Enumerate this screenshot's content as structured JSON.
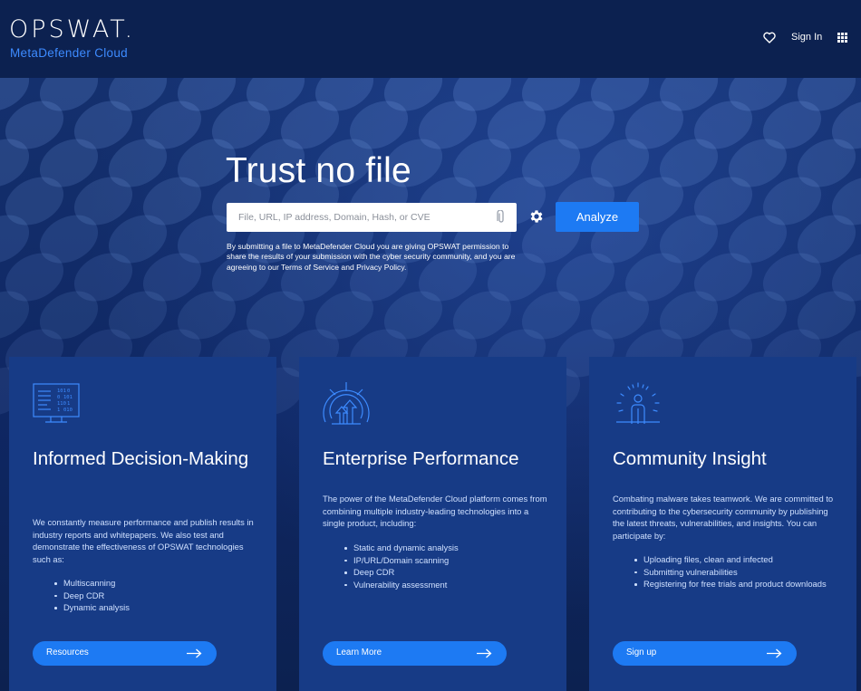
{
  "header": {
    "logo_word": "OPSWAT.",
    "logo_sub": "MetaDefender Cloud",
    "signin_label": "Sign In",
    "icons": [
      "heart-icon",
      "apps-grid-icon"
    ]
  },
  "hero": {
    "title": "Trust no file",
    "search_placeholder": "File, URL, IP address, Domain, Hash, or CVE",
    "analyze_label": "Analyze",
    "disclaimer": "By submitting a file to MetaDefender Cloud you are giving OPSWAT permission to share the results of your submission with the cyber security community, and you are agreeing to our Terms of Service and Privacy Policy.",
    "icons": [
      "paperclip-icon",
      "gear-icon"
    ]
  },
  "cards": [
    {
      "icon": "dashboard-screen-icon",
      "title": "Informed Decision-Making",
      "description": "We constantly measure performance and publish results in industry reports and whitepapers. We also test and demonstrate the effectiveness of OPSWAT technologies such as:",
      "items": [
        "Multiscanning",
        "Deep CDR",
        "Dynamic analysis"
      ],
      "button_label": "Resources"
    },
    {
      "icon": "radar-performance-icon",
      "title": "Enterprise Performance",
      "description": "The power of the MetaDefender Cloud platform comes from combining multiple industry-leading technologies into a single product, including:",
      "items": [
        "Static and dynamic analysis",
        "IP/URL/Domain scanning",
        "Deep CDR",
        "Vulnerability assessment"
      ],
      "button_label": "Learn More"
    },
    {
      "icon": "community-person-icon",
      "title": "Community Insight",
      "description": "Combating malware takes teamwork. We are committed to contributing to the cybersecurity community by publishing the latest threats, vulnerabilities, and insights. You can participate by:",
      "items": [
        "Uploading files, clean and infected",
        "Submitting vulnerabilities",
        "Registering for free trials and product downloads"
      ],
      "button_label": "Sign up"
    }
  ],
  "colors": {
    "background": "#0c2150",
    "card": "#173b86",
    "accent": "#1d7af3",
    "logo_sub": "#3d8bff"
  }
}
